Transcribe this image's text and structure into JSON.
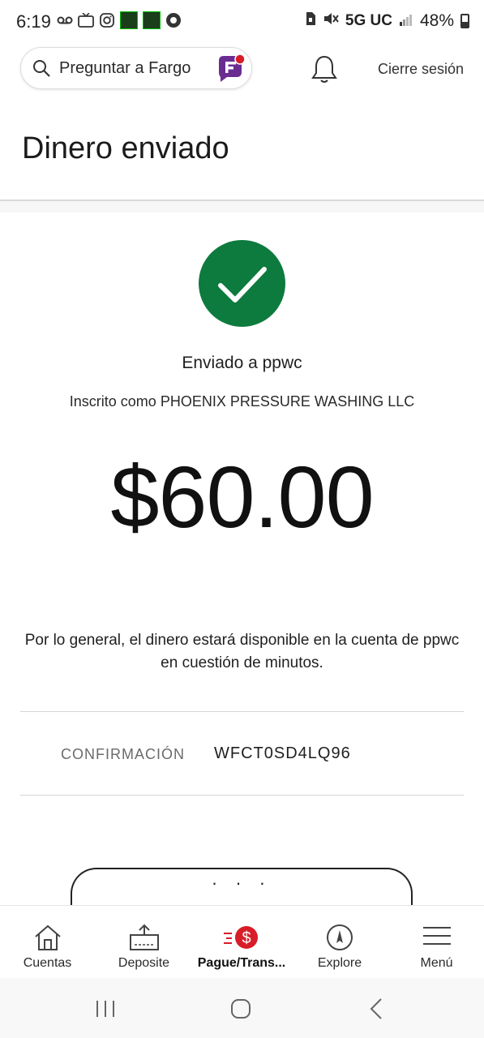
{
  "status_bar": {
    "time": "6:19",
    "network": "5G UC",
    "battery": "48%",
    "battery_level": 0.48,
    "left_icons": [
      "voicemail-icon",
      "tv-icon",
      "instagram-icon",
      "app-icon",
      "app-icon",
      "app-icon"
    ]
  },
  "header": {
    "search_label": "Preguntar a Fargo",
    "signout_label": "Cierre sesión"
  },
  "page": {
    "title": "Dinero enviado"
  },
  "confirmation": {
    "sent_to": "Enviado a ppwc",
    "enrolled_as": "Inscrito como PHOENIX PRESSURE WASHING LLC",
    "amount": "$60.00",
    "availability": "Por lo general, el dinero estará disponible en la cuenta de ppwc en cuestión de minutos.",
    "conf_label": "CONFIRMACIÓN",
    "conf_value": "WFCT0SD4LQ96",
    "more_button": "· · ·"
  },
  "tabs": [
    {
      "label": "Cuentas",
      "icon": "home-icon"
    },
    {
      "label": "Deposite",
      "icon": "deposit-icon"
    },
    {
      "label": "Pague/Trans...",
      "icon": "pay-transfer-icon",
      "active": true
    },
    {
      "label": "Explore",
      "icon": "compass-icon"
    },
    {
      "label": "Menú",
      "icon": "menu-icon"
    }
  ],
  "colors": {
    "success_green": "#0d7a3e",
    "brand_red": "#d71e28",
    "fargo_purple": "#6b2c91"
  }
}
